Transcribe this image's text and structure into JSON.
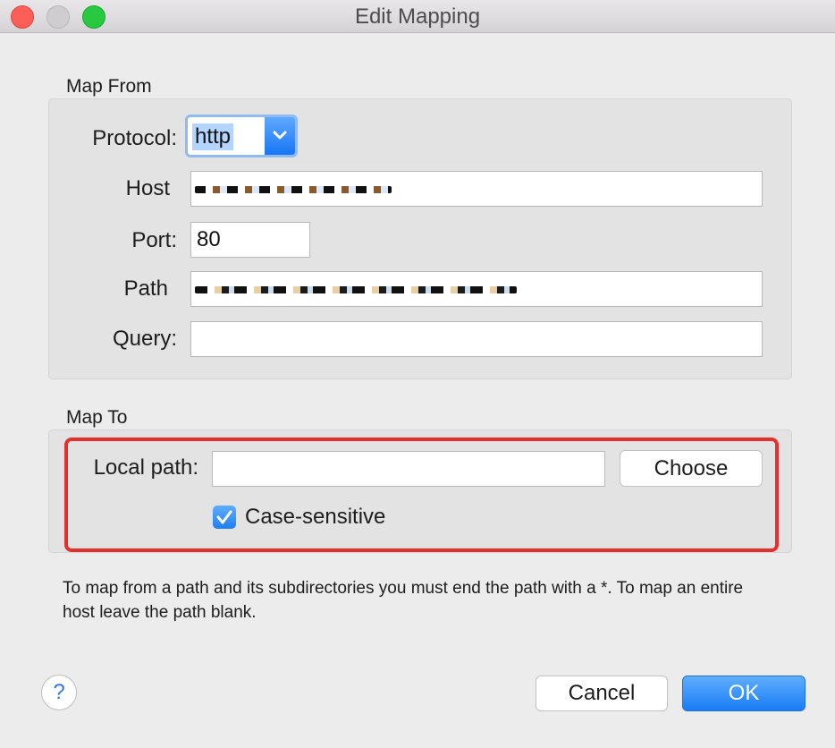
{
  "window": {
    "title": "Edit Mapping"
  },
  "map_from": {
    "label": "Map From",
    "protocol_label": "Protocol:",
    "protocol_value": "http",
    "host_label": "Host",
    "port_label": "Port:",
    "port_value": "80",
    "path_label": "Path",
    "query_label": "Query:",
    "query_value": ""
  },
  "map_to": {
    "label": "Map To",
    "local_path_label": "Local path:",
    "local_path_value": "",
    "choose_label": "Choose",
    "case_sensitive_label": "Case-sensitive",
    "case_sensitive_checked": true
  },
  "note": "To map from a path and its subdirectories you must end the path with a *. To map an entire host leave the path blank.",
  "footer": {
    "help_label": "?",
    "cancel_label": "Cancel",
    "ok_label": "OK"
  },
  "colors": {
    "accent": "#1a7cf4",
    "highlight": "#e5312e"
  }
}
